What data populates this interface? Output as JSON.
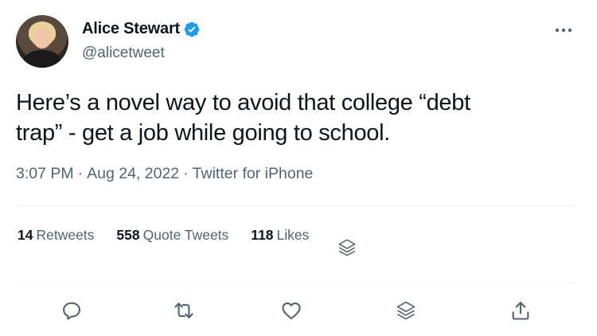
{
  "author": {
    "name": "Alice Stewart",
    "handle": "@alicetweet",
    "verified": true
  },
  "tweet": {
    "text_line1": "Here’s a novel way to avoid that college “debt",
    "text_line2": "trap” - get a job while going to school."
  },
  "meta": {
    "time": "3:07 PM",
    "separator1": "·",
    "date": "Aug 24, 2022",
    "separator2": "·",
    "source": "Twitter for iPhone"
  },
  "stats": {
    "retweets_count": "14",
    "retweets_label": "Retweets",
    "quotes_count": "558",
    "quotes_label": "Quote Tweets",
    "likes_count": "118",
    "likes_label": "Likes"
  },
  "icons": {
    "more": "more-horizontal-icon",
    "reply": "reply-icon",
    "retweet": "retweet-icon",
    "like": "heart-icon",
    "stack": "layers-icon",
    "share": "share-icon",
    "verified": "verified-badge-icon"
  },
  "colors": {
    "text": "#0f1419",
    "secondary": "#536471",
    "verified": "#1d9bf0",
    "divider": "#eff3f4"
  }
}
